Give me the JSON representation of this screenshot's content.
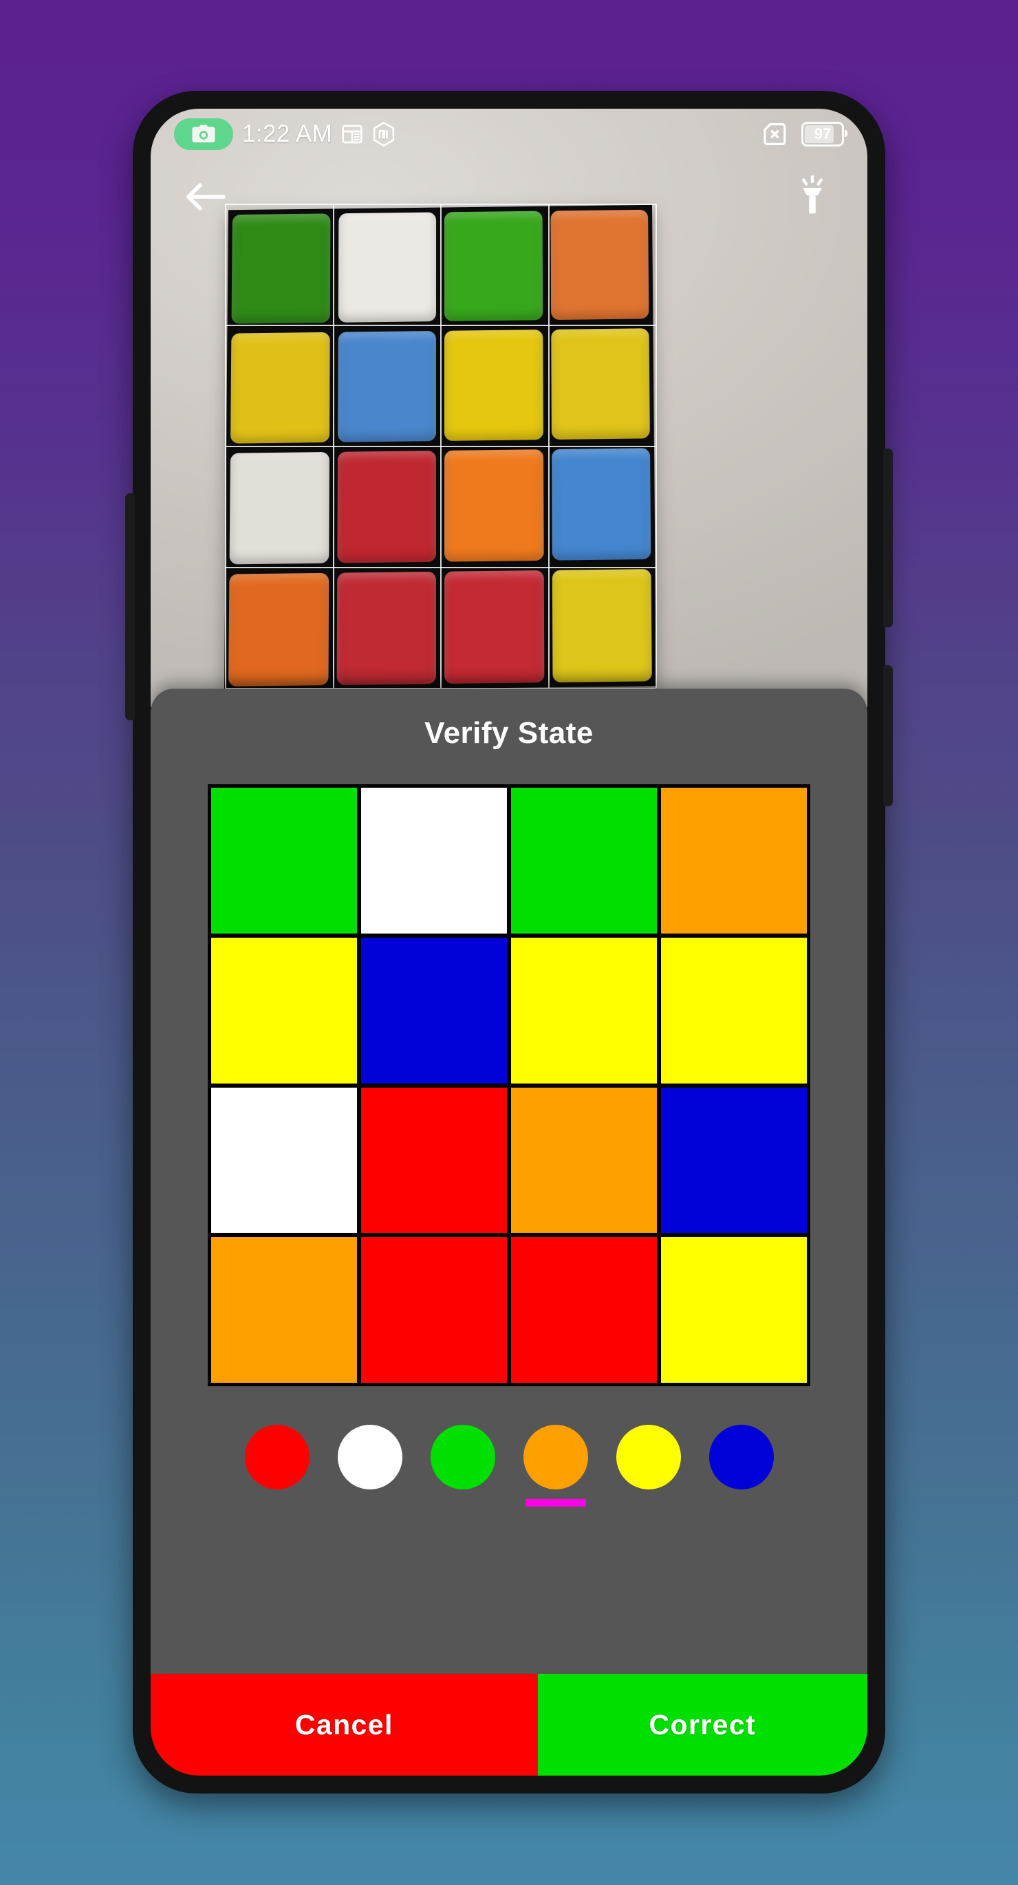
{
  "background": {
    "gradient_top": "#5c2091",
    "gradient_bottom": "#4587a9"
  },
  "status_bar": {
    "camera_badge_icon": "camera-icon",
    "camera_badge_color": "#5ed68b",
    "time": "1:22 AM",
    "notes_icon": "notes-icon",
    "mi_icon": "mi-hexagon-icon",
    "no_sim_icon": "no-sim-icon",
    "battery_level": "97",
    "battery_icon": "battery-icon"
  },
  "app_topbar": {
    "back_icon": "back-arrow-icon",
    "flashlight_icon": "flashlight-icon"
  },
  "camera_preview": {
    "description": "live camera view of a physical Rubik's cube face",
    "detected_rows": [
      [
        "#2f8a18",
        "#ece9e4",
        "#37a81c",
        "#e07431"
      ],
      [
        "#e0c017",
        "#4a86cd",
        "#e5c70f",
        "#e0c41a"
      ],
      [
        "#e2ded8",
        "#bf2730",
        "#ef7a1e",
        "#4486cf"
      ],
      [
        "#e0691f",
        "#bf2a33",
        "#c42a33",
        "#ddc519"
      ]
    ]
  },
  "dialog": {
    "title": "Verify State",
    "grid": {
      "rows": 4,
      "cols": 4,
      "cells": [
        [
          "green",
          "white",
          "green",
          "orange"
        ],
        [
          "yellow",
          "blue",
          "yellow",
          "yellow"
        ],
        [
          "white",
          "red",
          "orange",
          "blue"
        ],
        [
          "orange",
          "red",
          "red",
          "yellow"
        ]
      ],
      "hex": [
        [
          "#00e000",
          "#ffffff",
          "#00e000",
          "#ffa000"
        ],
        [
          "#ffff00",
          "#0000d8",
          "#ffff00",
          "#ffff00"
        ],
        [
          "#ffffff",
          "#ff0000",
          "#ffa000",
          "#0000d8"
        ],
        [
          "#ffa000",
          "#ff0000",
          "#ff0000",
          "#ffff00"
        ]
      ]
    },
    "palette": [
      {
        "name": "red",
        "hex": "#ff0000",
        "selected": false
      },
      {
        "name": "white",
        "hex": "#ffffff",
        "selected": false
      },
      {
        "name": "green",
        "hex": "#00e000",
        "selected": false
      },
      {
        "name": "orange",
        "hex": "#ffa000",
        "selected": true
      },
      {
        "name": "yellow",
        "hex": "#ffff00",
        "selected": false
      },
      {
        "name": "blue",
        "hex": "#0000d8",
        "selected": false
      }
    ],
    "selection_indicator_color": "#ff00e6",
    "actions": {
      "cancel_label": "Cancel",
      "cancel_color": "#ff0000",
      "correct_label": "Correct",
      "correct_color": "#00e000"
    }
  }
}
